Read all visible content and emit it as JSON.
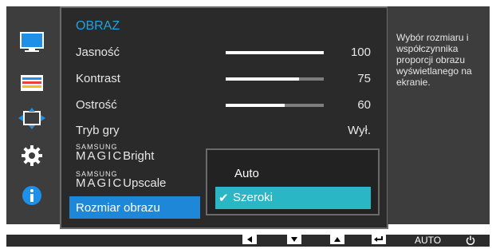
{
  "menu": {
    "title": "OBRAZ",
    "items": [
      {
        "label": "Jasność",
        "value": "100",
        "level": 100
      },
      {
        "label": "Kontrast",
        "value": "75",
        "level": 75
      },
      {
        "label": "Ostrość",
        "value": "60",
        "level": 60
      },
      {
        "label": "Tryb gry",
        "value": "Wył."
      },
      {
        "brand": "SAMSUNG",
        "name": "MAGIC",
        "suffix": "Bright"
      },
      {
        "brand": "SAMSUNG",
        "name": "MAGIC",
        "suffix": "Upscale"
      },
      {
        "label": "Rozmiar obrazu",
        "selected": true
      }
    ]
  },
  "popup": {
    "options": [
      {
        "label": "Auto",
        "selected": false
      },
      {
        "label": "Szeroki",
        "selected": true
      }
    ],
    "check_glyph": "✔"
  },
  "help": {
    "text": "Wybór rozmiaru i współczynnika proporcji obrazu wyświetlanego na ekranie."
  },
  "sidebar": {
    "icons": [
      "monitor-icon",
      "color-icon",
      "size-position-icon",
      "gear-icon",
      "info-icon"
    ]
  },
  "bottom_bar": {
    "keys": [
      "left-arrow-icon",
      "down-arrow-icon",
      "up-arrow-icon",
      "enter-icon"
    ],
    "auto_label": "AUTO",
    "power_icon": "power-icon"
  },
  "colors": {
    "accent_blue": "#1e87d8",
    "title_blue": "#1fa3e0",
    "selected_teal": "#2ab6c4"
  }
}
